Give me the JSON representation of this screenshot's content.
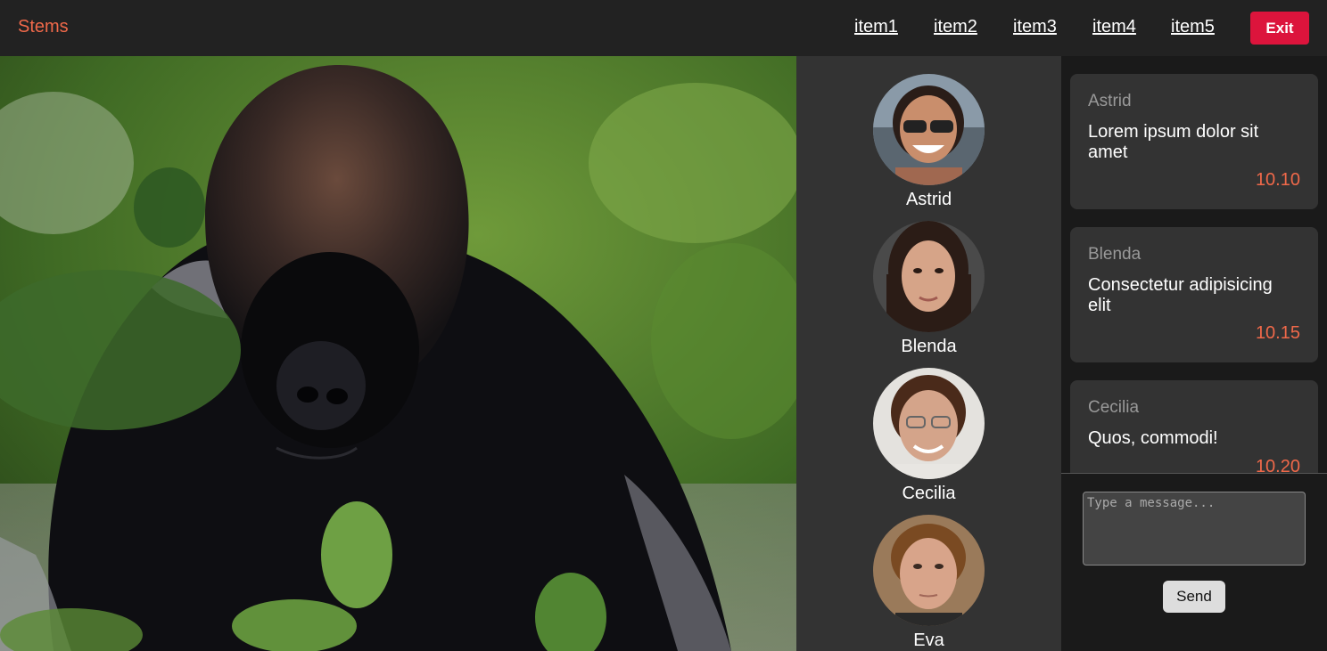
{
  "header": {
    "brand": "Stems",
    "nav": [
      "item1",
      "item2",
      "item3",
      "item4",
      "item5"
    ],
    "exit_label": "Exit"
  },
  "colors": {
    "accent": "#f0694a",
    "exit": "#dc143c",
    "topbar": "#222222",
    "panel": "#333333"
  },
  "main_image": {
    "subject": "gorilla photo"
  },
  "participants": [
    {
      "name": "Astrid"
    },
    {
      "name": "Blenda"
    },
    {
      "name": "Cecilia"
    },
    {
      "name": "Eva"
    }
  ],
  "messages": [
    {
      "sender": "Astrid",
      "text": "Lorem ipsum dolor sit amet",
      "time": "10.10"
    },
    {
      "sender": "Blenda",
      "text": "Consectetur adipisicing elit",
      "time": "10.15"
    },
    {
      "sender": "Cecilia",
      "text": "Quos, commodi!",
      "time": "10.20"
    }
  ],
  "composer": {
    "placeholder": "Type a message...",
    "send_label": "Send"
  }
}
